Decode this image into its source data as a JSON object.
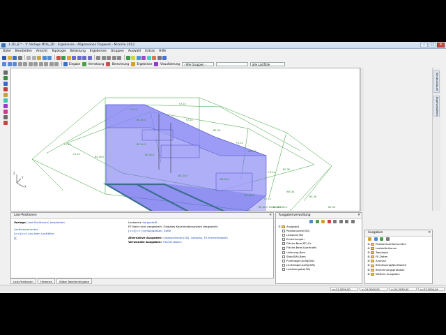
{
  "window": {
    "title": "1-2D_B * - 'z' Vorlage MOS_2D - Ergebnisse - Allgemeines Tragwerk - MicroFe 2012",
    "controls": [
      "–",
      "□",
      "✕"
    ]
  },
  "menu": [
    "Datei",
    "Bearbeiten",
    "Ansicht",
    "Topologie",
    "Belastung",
    "Ergebnisse",
    "Gruppen",
    "Auswahl",
    "Extras",
    "Hilfe"
  ],
  "toolbar2": {
    "eingabe": "Eingabe",
    "vernetzung": "Vernetzung",
    "berechnung": "Berechnung",
    "ergebnisse": "Ergebnisse",
    "visualisierung": "Visualisierung",
    "group_combo": "- Alle Gruppen -",
    "load_combo": "alle Lastfälle"
  },
  "right_tabs": {
    "strukturbaum": "Strukturbaum",
    "eigenschaften": "Eigenschaften"
  },
  "model_labels": [
    {
      "text": "BS-Gk.E"
    },
    {
      "text": "BS-Gk.E"
    },
    {
      "text": "BS-Gk.E"
    },
    {
      "text": "BS-Gk.E"
    },
    {
      "text": "BS-Gk.E"
    },
    {
      "text": "BS-Gk.E"
    },
    {
      "text": "BS-Gk.E"
    },
    {
      "text": "BS-Gk.E"
    },
    {
      "text": "BS-Gk.E"
    },
    {
      "text": "+Z-14"
    },
    {
      "text": "+Z-14"
    },
    {
      "text": "+Z-14"
    },
    {
      "text": "+Z-14"
    },
    {
      "text": "+Z-14"
    },
    {
      "text": "+Z-14"
    },
    {
      "text": "+Z-14"
    },
    {
      "text": "+Z-14"
    },
    {
      "text": "BS-36"
    },
    {
      "text": "BS-36"
    },
    {
      "text": "BS-36"
    },
    {
      "text": "BS-36"
    },
    {
      "text": "WR-36"
    },
    {
      "text": "WR-36"
    },
    {
      "text": "BS-Gk.E"
    },
    {
      "text": "BS-Gk.E"
    }
  ],
  "axes": {
    "z": "Z",
    "x": "X",
    "y": "Y"
  },
  "info_panel": {
    "title": "Last-Positionen",
    "vorlage_label": "Vorlage",
    "vorlage_link": "(Last-Positionen)",
    "vorlage_value": "bearbeiten",
    "lastkomponenten": "Lastkomponenten",
    "lastfall_links": "[<<][>>]",
    "lastfall_text": "aus allen Lastfällen",
    "right_line1_text": "Lastwerte",
    "right_line1_link": "dargestellt.",
    "right_line2": "FE-Netz nicht dargestellt. Globales Koordinatensystem dargestellt.",
    "right_line3_links": "[<<][>>]",
    "right_line3_link2": "Symbolgrößen, Stifte",
    "alternative_label": "Alternative Ausgaben:",
    "alternative_links": "Lastpositionen(3D), Lastplan, FE-Elementlasten",
    "verwandte_label": "Verwandte Ausgaben:",
    "verwandte_links": "Flächenlasten",
    "tabs": [
      "Last-Positionen",
      "Hinweise",
      "Stäbe Tabelleneingabe"
    ]
  },
  "ausgabe_panel": {
    "title": "Ausgabenverwaltung",
    "root": "Ausgabe1",
    "items": [
      "Positionsnetz(3D)",
      "Lastplan(3D)",
      "Einwirkungen",
      "Fläche-Bem(SF)-Ez",
      "Fläche-Bem(Querkraft)",
      "Unterzug-Bem",
      "Stab(SW)-Bem",
      "Punktlager-Auflg(SW)",
      "Linienlager-Auflg(SW)",
      "Lastübergabe(3D)"
    ]
  },
  "outputs_panel": {
    "title": "Ausgaben",
    "items": [
      "Positionsstellenfunkten",
      "Lastdefinitionen",
      "Topologie",
      "FE-Daten",
      "Analyse",
      "Bemessung/Nachweise",
      "Berechnungsprotokoll",
      "Weitere Ausgaben"
    ]
  },
  "status": [
    "x=21,5000,00",
    "y=24,5000,00",
    "z=24,5030,00",
    "x=22,3000,04"
  ],
  "colors": {
    "accent": "#1a49b8",
    "model_fill": "#6e6ef0",
    "wire": "#2f9b2f",
    "slab_edge": "#3a6f8c"
  }
}
